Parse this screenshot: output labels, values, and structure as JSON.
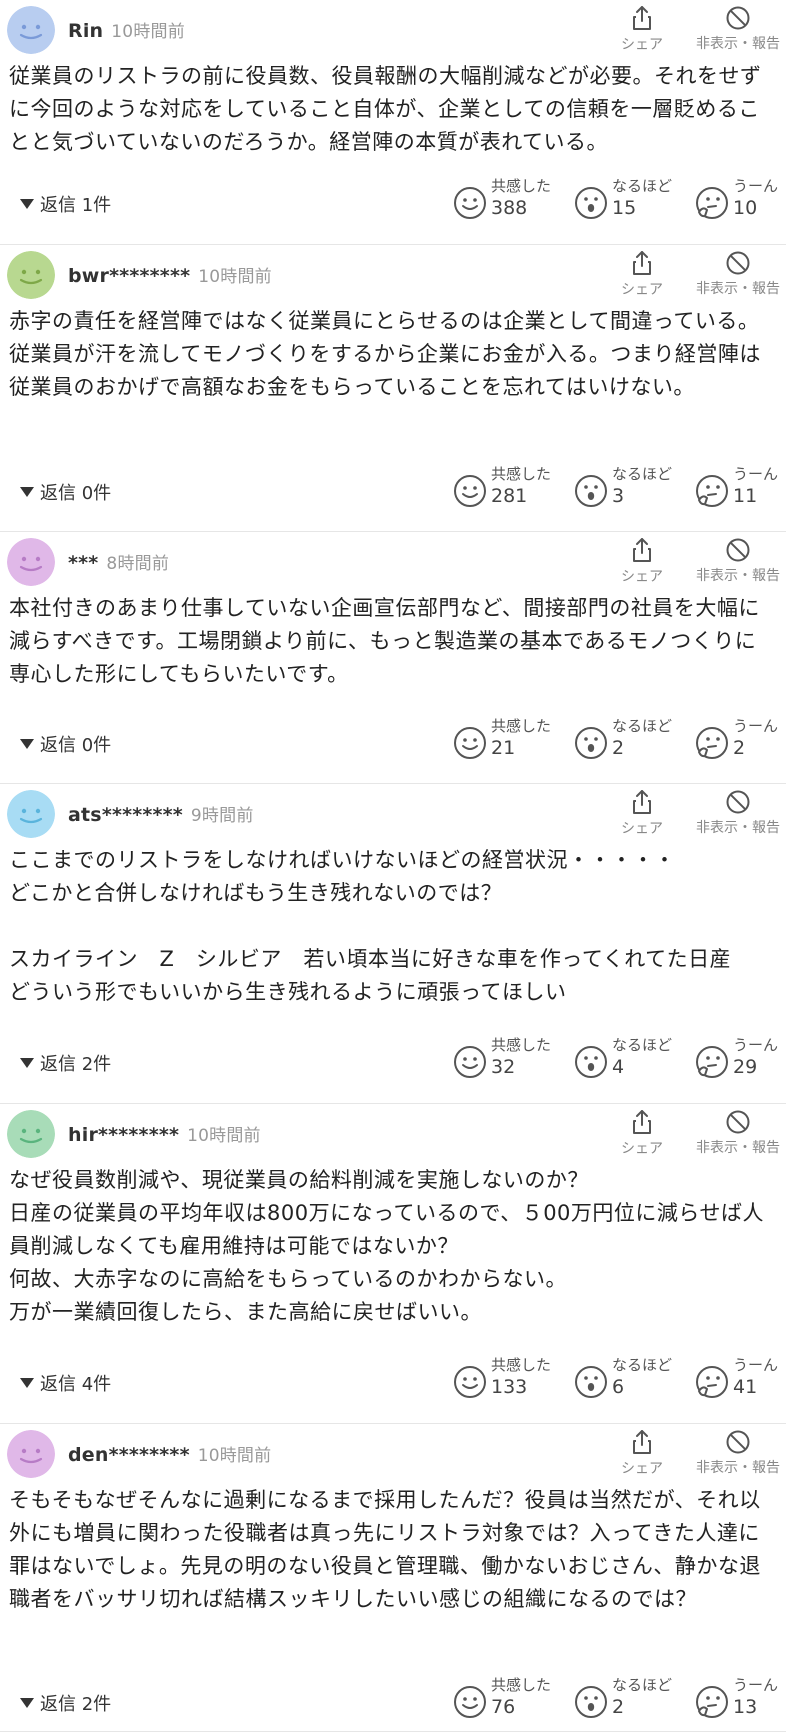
{
  "labels": {
    "share": "シェア",
    "hide_report": "非表示・報告",
    "empathy": "共感した",
    "insight": "なるほど",
    "hmm": "うーん"
  },
  "colors": {
    "avatar_blue": "#b8cdf0",
    "avatar_green": "#b8d890",
    "avatar_purple": "#e0b8e8",
    "avatar_cyan": "#a8dcf4",
    "avatar_teal": "#a8dcb8"
  },
  "comments": [
    {
      "user": "Rin",
      "time": "10時間前",
      "avatar": "blue",
      "text": "従業員のリストラの前に役員数、役員報酬の大幅削減などが必要。それをせずに今回のような対応をしていること自体が、企業としての信頼を一層貶めることと気づいていないのだろうか。経営陣の本質が表れている。",
      "replies": "返信 1件",
      "empathy": "388",
      "insight": "15",
      "hmm": "10"
    },
    {
      "user": "bwr********",
      "time": "10時間前",
      "avatar": "green",
      "text": "赤字の責任を経営陣ではなく従業員にとらせるのは企業として間違っている。\n従業員が汗を流してモノづくりをするから企業にお金が入る。つまり経営陣は従業員のおかげで高額なお金をもらっていることを忘れてはいけない。",
      "replies": "返信 0件",
      "empathy": "281",
      "insight": "3",
      "hmm": "11"
    },
    {
      "user": "***",
      "time": "8時間前",
      "avatar": "purple",
      "text": "本社付きのあまり仕事していない企画宣伝部門など、間接部門の社員を大幅に減らすべきです。工場閉鎖より前に、もっと製造業の基本であるモノつくりに専心した形にしてもらいたいです。",
      "replies": "返信 0件",
      "empathy": "21",
      "insight": "2",
      "hmm": "2"
    },
    {
      "user": "ats********",
      "time": "9時間前",
      "avatar": "cyan",
      "text": "ここまでのリストラをしなければいけないほどの経営状況・・・・・\nどこかと合併しなければもう生き残れないのでは？\n\nスカイライン　Z　シルビア　若い頃本当に好きな車を作ってくれてた日産\nどういう形でもいいから生き残れるように頑張ってほしい",
      "replies": "返信 2件",
      "empathy": "32",
      "insight": "4",
      "hmm": "29"
    },
    {
      "user": "hir********",
      "time": "10時間前",
      "avatar": "teal",
      "text": "なぜ役員数削減や、現従業員の給料削減を実施しないのか？\n日産の従業員の平均年収は800万になっているので、５00万円位に減らせば人員削減しなくても雇用維持は可能ではないか？\n何故、大赤字なのに高給をもらっているのかわからない。\n万が一業績回復したら、また高給に戻せばいい。",
      "replies": "返信 4件",
      "empathy": "133",
      "insight": "6",
      "hmm": "41"
    },
    {
      "user": "den********",
      "time": "10時間前",
      "avatar": "purple",
      "text": "そもそもなぜそんなに過剰になるまで採用したんだ？役員は当然だが、それ以外にも増員に関わった役職者は真っ先にリストラ対象では？入ってきた人達に罪はないでしょ。先見の明のない役員と管理職、働かないおじさん、静かな退職者をバッサリ切れば結構スッキリしたいい感じの組織になるのでは？",
      "replies": "返信 2件",
      "empathy": "76",
      "insight": "2",
      "hmm": "13"
    }
  ]
}
